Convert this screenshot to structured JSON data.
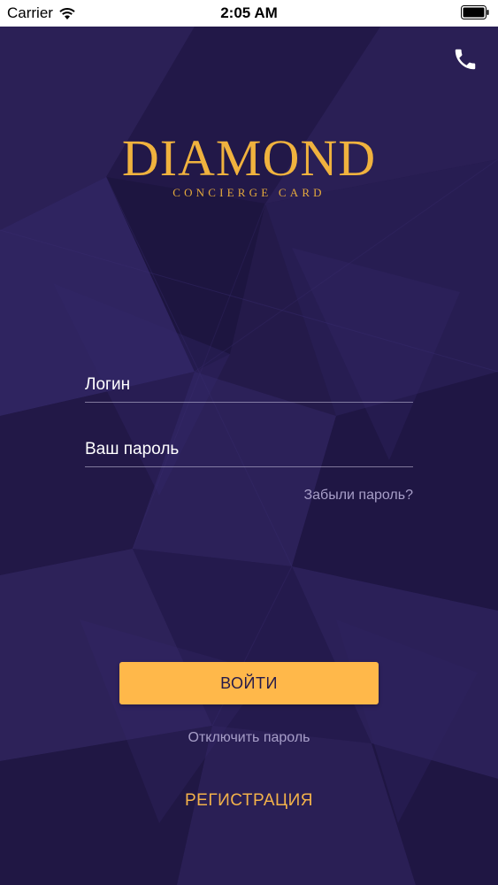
{
  "status_bar": {
    "carrier": "Carrier",
    "time": "2:05 AM"
  },
  "icons": {
    "wifi": "wifi-icon",
    "battery": "battery-icon",
    "phone": "phone-icon"
  },
  "logo": {
    "title": "DIAMOND",
    "subtitle": "CONCIERGE CARD"
  },
  "form": {
    "login_placeholder": "Логин",
    "password_placeholder": "Ваш пароль",
    "forgot_password": "Забыли пароль?",
    "submit_label": "ВОЙТИ",
    "disable_password": "Отключить пароль",
    "register_label": "РЕГИСТРАЦИЯ"
  },
  "colors": {
    "background": "#241a4a",
    "accent": "#ffb84a",
    "gold": "#f0b23e",
    "muted_text": "#a79ec8"
  }
}
